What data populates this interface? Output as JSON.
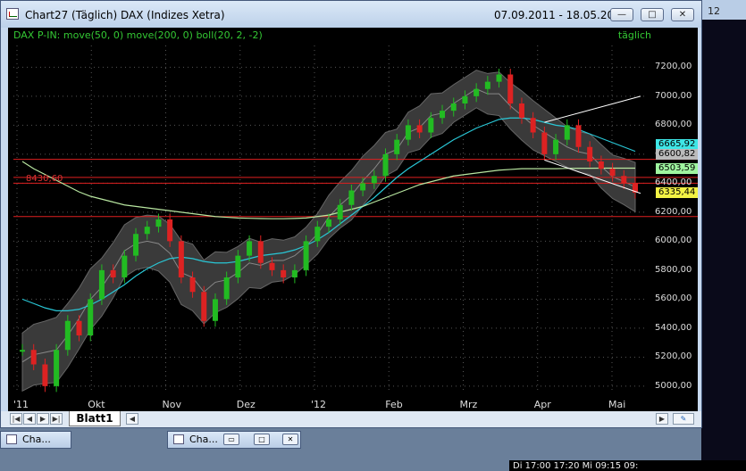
{
  "window": {
    "title": "Chart27 (Täglich)  DAX (Indizes Xetra)",
    "date_range": "07.09.2011 - 18.05.2012",
    "minimize_label": "—",
    "maximize_label": "□",
    "close_label": "✕"
  },
  "chart": {
    "legend": "DAX P-IN: move(50, 0) move(200, 0) boll(20, 2, -2)",
    "frequency": "täglich",
    "annotation": "8430,60",
    "value_labels": [
      "6665,92",
      "6600,82",
      "6503,59",
      "6335,44"
    ],
    "value_colors": [
      "#3ee6e6",
      "#bbbbbb",
      "#9ff59f",
      "#f2f244"
    ]
  },
  "chart_data": {
    "type": "line",
    "y_ticks": [
      "7200,00",
      "7000,00",
      "6800,00",
      "6600,00",
      "6400,00",
      "6200,00",
      "6000,00",
      "5800,00",
      "5600,00",
      "5400,00",
      "5200,00",
      "5000,00"
    ],
    "y_range": [
      4950,
      7350
    ],
    "x_ticks": [
      "'11",
      "Okt",
      "Nov",
      "Dez",
      "'12",
      "Feb",
      "Mrz",
      "Apr",
      "Mai"
    ],
    "series": [
      {
        "values": [
          5250,
          5150,
          5000,
          5250,
          5450,
          5350,
          5600,
          5800,
          5750,
          5900,
          6050,
          6100,
          6150,
          6000,
          5750,
          5650,
          5450,
          5600,
          5750,
          5900,
          6000,
          5850,
          5800,
          5750,
          5800,
          6000,
          6100,
          6150,
          6250,
          6350,
          6400,
          6450,
          6600,
          6700,
          6800,
          6750,
          6850,
          6900,
          6950,
          7000,
          7050,
          7100,
          7150,
          6950,
          6850,
          6750,
          6600,
          6700,
          6800,
          6650,
          6550,
          6500,
          6450,
          6400,
          6335
        ]
      }
    ],
    "sma50": [
      5600,
      5570,
      5540,
      5520,
      5520,
      5530,
      5560,
      5600,
      5650,
      5700,
      5760,
      5810,
      5850,
      5880,
      5890,
      5880,
      5860,
      5850,
      5850,
      5860,
      5880,
      5900,
      5910,
      5920,
      5940,
      5970,
      6010,
      6060,
      6120,
      6180,
      6240,
      6300,
      6370,
      6440,
      6500,
      6550,
      6600,
      6650,
      6700,
      6740,
      6780,
      6810,
      6840,
      6850,
      6850,
      6840,
      6820,
      6800,
      6790,
      6770,
      6740,
      6710,
      6680,
      6650,
      6620
    ],
    "sma200": [
      6550,
      6500,
      6460,
      6420,
      6380,
      6340,
      6310,
      6290,
      6270,
      6250,
      6240,
      6230,
      6220,
      6210,
      6200,
      6190,
      6180,
      6170,
      6165,
      6160,
      6158,
      6156,
      6155,
      6155,
      6157,
      6160,
      6170,
      6180,
      6200,
      6220,
      6240,
      6270,
      6300,
      6330,
      6360,
      6390,
      6410,
      6430,
      6450,
      6460,
      6470,
      6480,
      6490,
      6495,
      6500,
      6500,
      6500,
      6500,
      6502,
      6503,
      6503,
      6504,
      6504,
      6504,
      6504
    ],
    "horizontal_levels": [
      6565,
      6440,
      6400,
      6170
    ],
    "band_width": [
      400,
      420,
      430,
      450,
      440,
      420,
      420,
      400,
      380,
      360,
      360,
      360,
      380,
      400,
      440,
      460,
      440,
      420,
      380,
      360,
      340,
      320,
      300,
      280,
      260,
      260,
      280,
      300,
      320,
      340,
      340,
      320,
      300,
      280,
      280,
      300,
      300,
      280,
      260,
      260,
      260,
      280,
      300,
      320,
      340,
      340,
      320,
      300,
      280,
      280,
      280,
      300,
      300,
      320,
      340
    ]
  },
  "tabs": {
    "sheet": "Blatt1"
  },
  "minimized": [
    {
      "label": "Cha..."
    },
    {
      "label": "Cha..."
    }
  ],
  "background": {
    "left_number": "12",
    "bottom_text": "Di       17:00   17:20      Mi   09:15   09:"
  }
}
